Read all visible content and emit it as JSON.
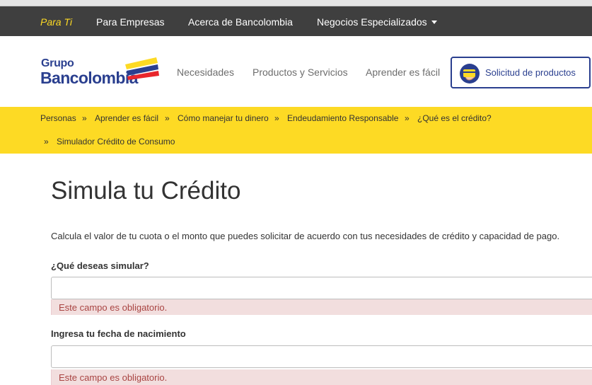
{
  "top_nav": {
    "items": [
      {
        "label": "Para Ti",
        "active": true
      },
      {
        "label": "Para Empresas"
      },
      {
        "label": "Acerca de Bancolombia"
      },
      {
        "label": "Negocios Especializados",
        "has_dropdown": true
      }
    ]
  },
  "header": {
    "logo": {
      "line1": "Grupo",
      "line2": "Bancolombia"
    },
    "nav": [
      "Necesidades",
      "Productos y Servicios",
      "Aprender es fácil"
    ],
    "cta_label": "Solicitud de productos"
  },
  "breadcrumb": {
    "separator": "»",
    "items": [
      "Personas",
      "Aprender es fácil",
      "Cómo manejar tu dinero",
      "Endeudamiento Responsable",
      "¿Qué es el crédito?",
      "Simulador Crédito de Consumo"
    ]
  },
  "main": {
    "title": "Simula tu Crédito",
    "description": "Calcula el valor de tu cuota o el monto que puedes solicitar de acuerdo con tus necesidades de crédito y capacidad de pago.",
    "fields": [
      {
        "label": "¿Qué deseas simular?",
        "value": "",
        "error": "Este campo es obligatorio."
      },
      {
        "label": "Ingresa tu fecha de nacimiento",
        "value": "",
        "error": "Este campo es obligatorio."
      }
    ]
  },
  "colors": {
    "brand_blue": "#2a3f8f",
    "brand_yellow": "#fdda24",
    "brand_red": "#e8262c",
    "top_nav_bg": "#3f3f3f",
    "error_bg": "#f2dede",
    "error_text": "#a94442"
  },
  "icons": [
    "caret-down-icon",
    "credit-card-request-icon",
    "bancolombia-logo-mark"
  ]
}
